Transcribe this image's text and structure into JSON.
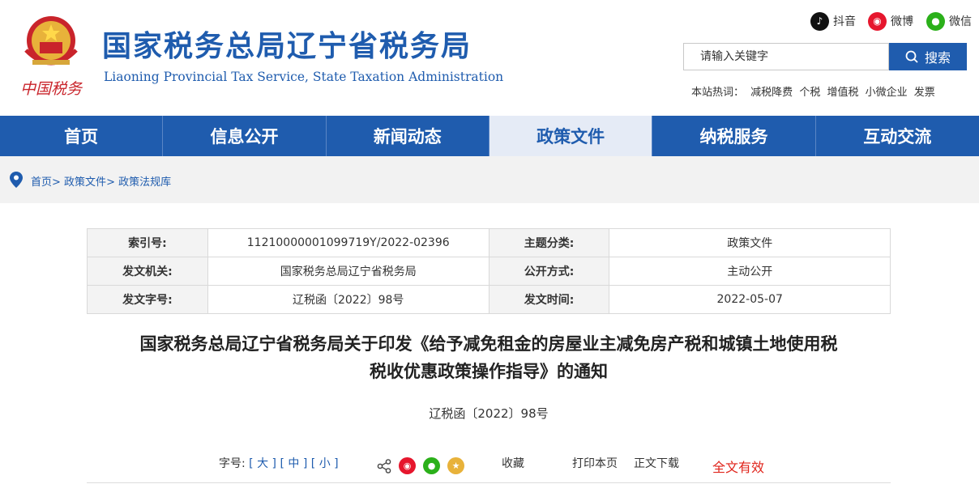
{
  "header": {
    "emblem_text": "中国税务",
    "title_cn": "国家税务总局辽宁省税务局",
    "title_en": "Liaoning Provincial Tax Service, State Taxation Administration"
  },
  "social": {
    "douyin": "抖音",
    "weibo": "微博",
    "wechat": "微信"
  },
  "search": {
    "placeholder": "请输入关键字",
    "button": "搜索"
  },
  "hot": {
    "label": "本站热词：",
    "words": [
      "减税降费",
      "个税",
      "增值税",
      "小微企业",
      "发票"
    ]
  },
  "nav": {
    "items": [
      "首页",
      "信息公开",
      "新闻动态",
      "政策文件",
      "纳税服务",
      "互动交流"
    ],
    "active": "政策文件"
  },
  "breadcrumb": {
    "items": [
      "首页",
      "政策文件",
      "政策法规库"
    ]
  },
  "meta": {
    "index_label": "索引号:",
    "index_value": "11210000001099719Y/2022-02396",
    "topic_label": "主题分类:",
    "topic_value": "政策文件",
    "issuer_label": "发文机关:",
    "issuer_value": "国家税务总局辽宁省税务局",
    "public_label": "公开方式:",
    "public_value": "主动公开",
    "docno_label": "发文字号:",
    "docno_value": "辽税函〔2022〕98号",
    "date_label": "发文时间:",
    "date_value": "2022-05-07"
  },
  "document": {
    "title_line1": "国家税务总局辽宁省税务局关于印发《给予减免租金的房屋业主减免房产税和城镇土地使用税",
    "title_line2": "税收优惠政策操作指导》的通知",
    "number": "辽税函〔2022〕98号"
  },
  "toolbar": {
    "font_label": "字号:",
    "font_large": "大",
    "font_medium": "中",
    "font_small": "小",
    "favorite": "收藏",
    "print": "打印本页",
    "download": "正文下载",
    "validity": "全文有效"
  },
  "colors": {
    "brand_blue": "#1f5cae",
    "valid_red": "#e0241b"
  }
}
